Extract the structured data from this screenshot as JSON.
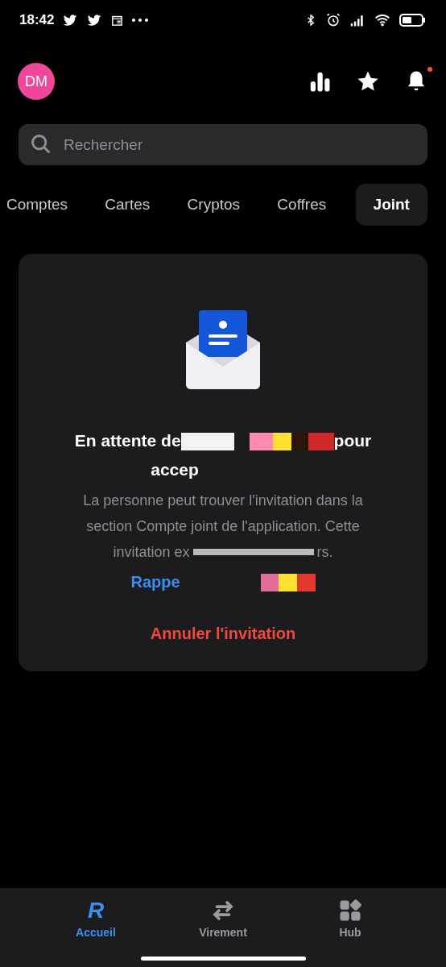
{
  "status_bar": {
    "time": "18:42"
  },
  "header": {
    "avatar": "DM",
    "notification_badge": true
  },
  "search": {
    "placeholder": "Rechercher"
  },
  "tabs": [
    {
      "label": "Comptes",
      "selected": false
    },
    {
      "label": "Cartes",
      "selected": false
    },
    {
      "label": "Cryptos",
      "selected": false
    },
    {
      "label": "Coffres",
      "selected": false
    },
    {
      "label": "Joint",
      "selected": true
    }
  ],
  "card": {
    "title_start": "En attente de",
    "title_end": "pour",
    "title_line2": "accep",
    "body_start": "La personne peut trouver l'invitation dans la section Compte joint de l'application. Cette",
    "body_mid": "invitation ex",
    "body_end": "rs.",
    "link": "Rappe",
    "cancel": "Annuler l'invitation"
  },
  "nav": [
    {
      "kind": "logo",
      "glyph": "R",
      "label": "Accueil",
      "selected": true
    },
    {
      "kind": "transfer",
      "label": "Virement",
      "selected": false
    },
    {
      "kind": "hub",
      "label": "Hub",
      "selected": false
    }
  ]
}
